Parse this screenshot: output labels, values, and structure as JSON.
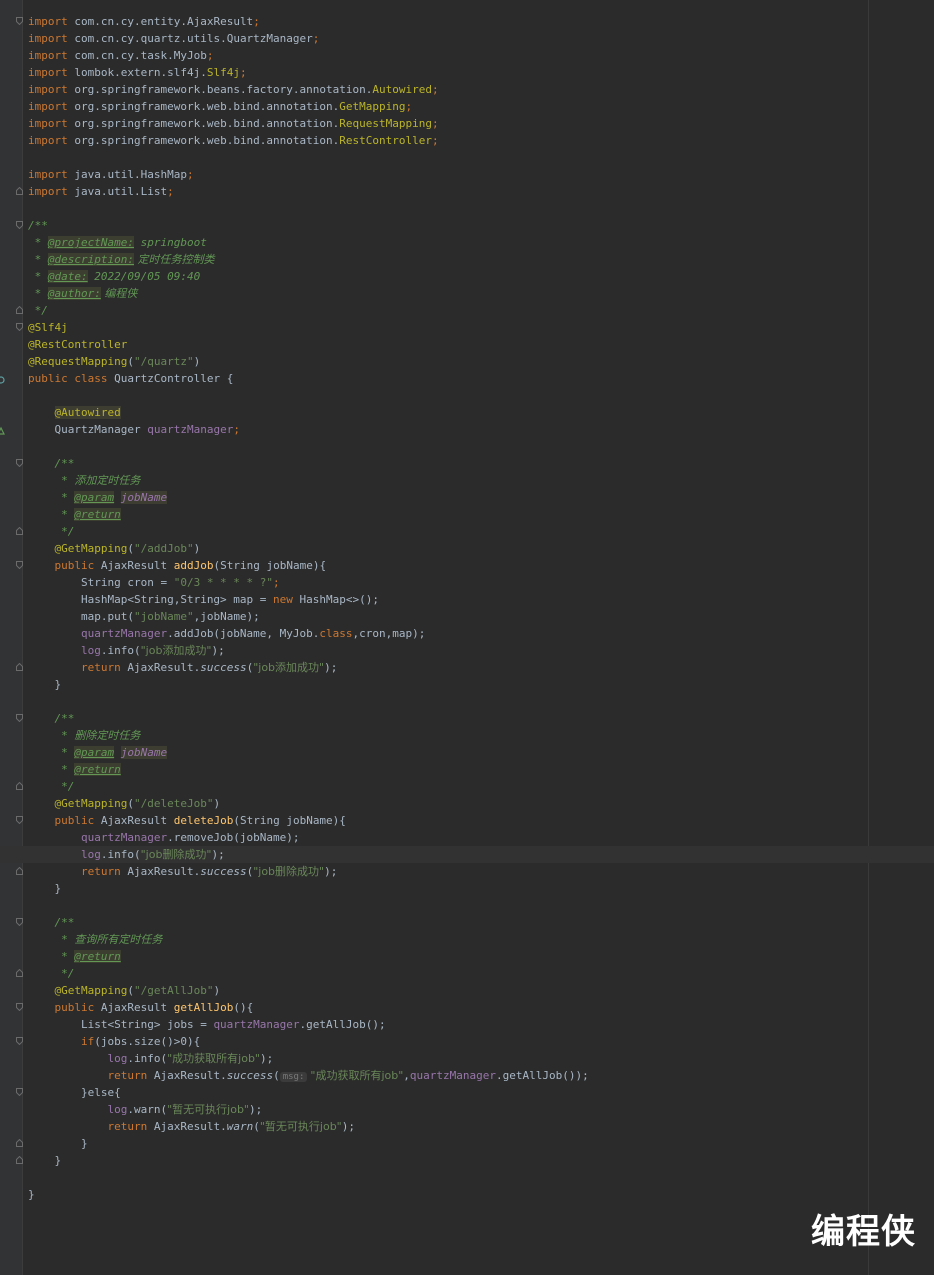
{
  "editor": {
    "imports": [
      {
        "pkg": "com.cn.cy.entity.AjaxResult",
        "highlight": ""
      },
      {
        "pkg": "com.cn.cy.quartz.utils.QuartzManager",
        "highlight": ""
      },
      {
        "pkg": "com.cn.cy.task.MyJob",
        "highlight": ""
      },
      {
        "pkg": "lombok.extern.slf4j.",
        "highlight": "Slf4j"
      },
      {
        "pkg": "org.springframework.beans.factory.annotation.",
        "highlight": "Autowired"
      },
      {
        "pkg": "org.springframework.web.bind.annotation.",
        "highlight": "GetMapping"
      },
      {
        "pkg": "org.springframework.web.bind.annotation.",
        "highlight": "RequestMapping"
      },
      {
        "pkg": "org.springframework.web.bind.annotation.",
        "highlight": "RestController"
      },
      {
        "pkg": "java.util.HashMap",
        "highlight": ""
      },
      {
        "pkg": "java.util.List",
        "highlight": ""
      }
    ],
    "tokens": {
      "import_kw": "import",
      "public_kw": "public",
      "class_kw": "class",
      "return_kw": "return",
      "new_kw": "new",
      "if_kw": "if",
      "else_kw": "else",
      "semicolon": ";",
      "doc_open": "/**",
      "doc_star": " * ",
      "doc_close": " */",
      "brace_close": "}"
    },
    "class_doc": {
      "project_tag": "@projectName:",
      "project_val": " springboot",
      "description_tag": "@description:",
      "description_val": " 定时任务控制类",
      "date_tag": "@date:",
      "date_val": " 2022/09/05 09:40",
      "author_tag": "@author:",
      "author_val": " 编程侠"
    },
    "class_annotations": [
      "@Slf4j",
      "@RestController"
    ],
    "request_mapping": {
      "name": "@RequestMapping",
      "path": "\"/quartz\""
    },
    "class_decl": {
      "name": " QuartzController {"
    },
    "field": {
      "annotation": "@Autowired",
      "type": "QuartzManager ",
      "name": "quartzManager"
    },
    "common": {
      "param_tag": "@param",
      "param_name": "jobName",
      "return_tag": "@return",
      "get_mapping": "@GetMapping",
      "ajax_result": "AjaxResult ",
      "ajax_result_dot": "AjaxResult.",
      "success": "success",
      "warn": "warn",
      "log": "log",
      "info": ".info(",
      "warn_call": ".warn(",
      "qm": "quartzManager",
      "close_call": ");",
      "param_sig": "(String jobName){"
    },
    "add_job": {
      "doc": "添加定时任务",
      "path": "\"/addJob\"",
      "name": "addJob",
      "cron_decl": "String cron = ",
      "cron_val": "\"0/3 * * * * ?\"",
      "map_decl": "HashMap<String,String> map = ",
      "map_new": " HashMap<>();",
      "put_call": "map.put(",
      "put_key": "\"jobName\"",
      "put_rest": ",jobName);",
      "add_call": ".addJob(jobName, MyJob.",
      "add_rest": ",cron,map);",
      "log_msg": "\"job添加成功\"",
      "ret_msg": "\"job添加成功\""
    },
    "delete_job": {
      "doc": "删除定时任务",
      "path": "\"/deleteJob\"",
      "name": "deleteJob",
      "remove_call": ".removeJob(jobName);",
      "log_msg": "\"job删除成功\"",
      "ret_msg": "\"job删除成功\""
    },
    "get_all_job": {
      "doc": "查询所有定时任务",
      "path": "\"/getAllJob\"",
      "name": "getAllJob",
      "sig": "(){",
      "list_decl": "List<String> jobs = ",
      "list_call": ".getAllJob();",
      "if_cond": "(jobs.size()>0){",
      "log_msg": "\"成功获取所有job\"",
      "hint": "msg:",
      "ret_msg": "\"成功获取所有job\"",
      "ret_rest": ".getAllJob());",
      "else_open": "}else{",
      "warn_msg": "\"暂无可执行job\"",
      "warn_ret": "\"暂无可执行job\""
    }
  },
  "watermark": {
    "text": "编程侠"
  },
  "colors": {
    "background": "#2b2b2b",
    "keyword": "#cc7832",
    "annotation": "#bbb529",
    "string": "#6a8759",
    "field": "#9876aa",
    "method": "#ffc66d",
    "doc": "#629755",
    "text": "#a9b7c6"
  }
}
